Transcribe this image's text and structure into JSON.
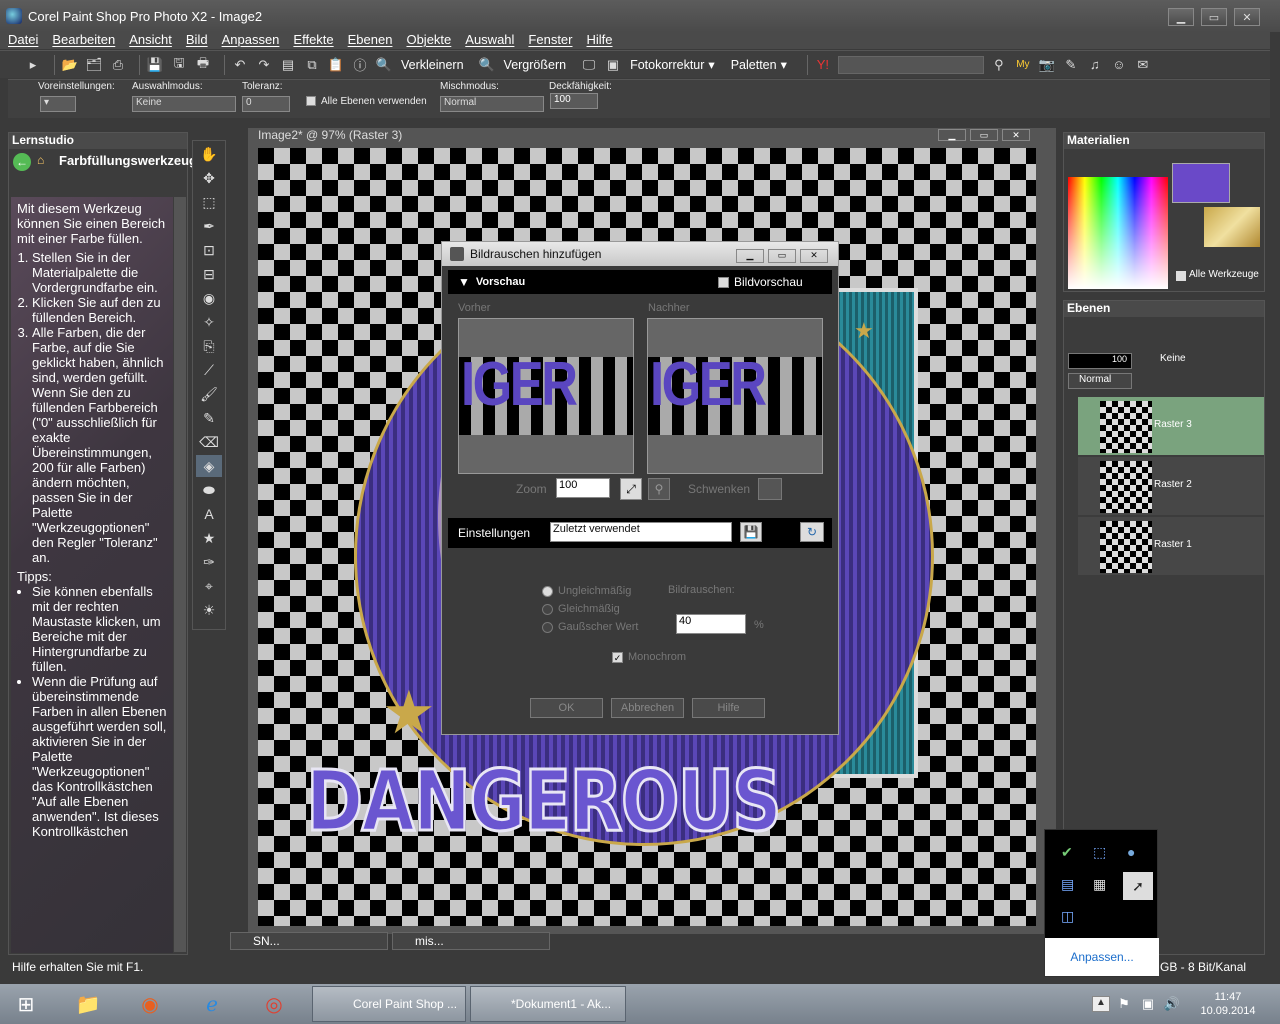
{
  "window": {
    "title": "Corel Paint Shop Pro Photo X2 - Image2"
  },
  "menu": [
    "Datei",
    "Bearbeiten",
    "Ansicht",
    "Bild",
    "Anpassen",
    "Effekte",
    "Ebenen",
    "Objekte",
    "Auswahl",
    "Fenster",
    "Hilfe"
  ],
  "toolbar": {
    "shrink": "Verkleinern",
    "enlarge": "Vergrößern",
    "photo_fix": "Fotokorrektur",
    "palettes": "Paletten"
  },
  "options": {
    "presets_label": "Voreinstellungen:",
    "mode_label": "Auswahlmodus:",
    "mode_value": "Keine",
    "tolerance_label": "Toleranz:",
    "tolerance_value": "0",
    "all_layers_label": "Alle Ebenen verwenden",
    "blend_label": "Mischmodus:",
    "blend_value": "Normal",
    "opacity_label": "Deckfähigkeit:",
    "opacity_value": "100"
  },
  "lernstudio": {
    "title": "Lernstudio",
    "tool_title": "Farbfüllungswerkzeug",
    "intro": "Mit diesem Werkzeug können Sie einen Bereich mit einer Farbe füllen.",
    "steps": [
      "Stellen Sie in der Materialpalette die Vordergrundfarbe ein.",
      "Klicken Sie auf den zu füllenden Bereich.",
      "Alle Farben, die der Farbe, auf die Sie geklickt haben, ähnlich sind, werden gefüllt. Wenn Sie den zu füllenden Farbbereich (\"0\" ausschließlich für exakte Übereinstimmungen, 200 für alle Farben) ändern möchten, passen Sie in der Palette \"Werkzeugoptionen\" den Regler \"Toleranz\" an."
    ],
    "tips_label": "Tipps:",
    "tips": [
      "Sie können ebenfalls mit der rechten Maustaste klicken, um Bereiche mit der Hintergrundfarbe zu füllen.",
      "Wenn die Prüfung auf übereinstimmende Farben in allen Ebenen ausgeführt werden soll, aktivieren Sie in der Palette \"Werkzeugoptionen\" das Kontrollkästchen \"Auf alle Ebenen anwenden\". Ist dieses Kontrollkästchen"
    ]
  },
  "image_window": {
    "title": "Image2* @ 97% (Raster 3)"
  },
  "artwork": {
    "text": "DANGEROUS"
  },
  "dialog": {
    "title": "Bildrauschen hinzufügen",
    "preview_section": "Vorschau",
    "image_preview": "Bildvorschau",
    "before": "Vorher",
    "after": "Nachher",
    "preview_text": "IGER",
    "zoom_label": "Zoom",
    "zoom_value": "100",
    "pan_label": "Schwenken",
    "settings_label": "Einstellungen",
    "settings_value": "Zuletzt verwendet",
    "options": [
      "Ungleichmäßig",
      "Gleichmäßig",
      "Gaußscher Wert"
    ],
    "noise_label": "Bildrauschen:",
    "noise_value": "40",
    "percent": "%",
    "monochrome": "Monochrom",
    "ok": "OK",
    "cancel": "Abbrechen",
    "help": "Hilfe"
  },
  "materials": {
    "title": "Materialien",
    "all_tools": "Alle Werkzeuge"
  },
  "layers": {
    "title": "Ebenen",
    "blend": "Normal",
    "opacity": "100",
    "mask": "Keine",
    "items": [
      "Raster 3",
      "Raster 2",
      "Raster 1"
    ]
  },
  "minimized": [
    "SN...",
    "mis..."
  ],
  "status": {
    "help": "Hilfe erhalten Sie mit F1.",
    "info": "GB - 8 Bit/Kanal"
  },
  "tray": {
    "customize": "Anpassen...",
    "time": "11:47",
    "date": "10.09.2014"
  },
  "taskbar": {
    "psp": "Corel Paint Shop ...",
    "doc": "*Dokument1 - Ak..."
  }
}
